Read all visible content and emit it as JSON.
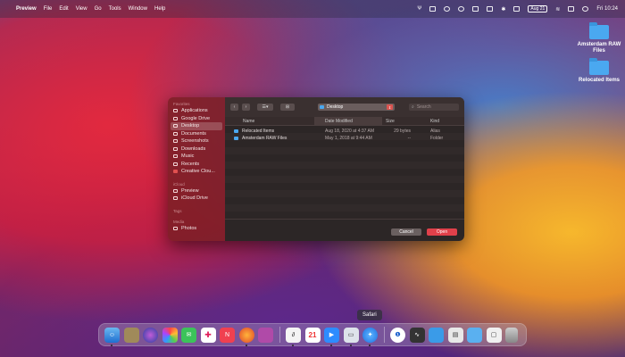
{
  "menubar": {
    "app_name": "Preview",
    "menus": [
      "File",
      "Edit",
      "View",
      "Go",
      "Tools",
      "Window",
      "Help"
    ],
    "date_chip": "Aug 21",
    "clock": "Fri 10:24"
  },
  "desktop": {
    "folders": [
      "Amsterdam RAW Files",
      "Relocated Items"
    ]
  },
  "dialog": {
    "sidebar": {
      "favorites_label": "Favorites",
      "favorites": [
        "Applications",
        "Google Drive",
        "Desktop",
        "Documents",
        "Screenshots",
        "Downloads",
        "Music",
        "Recents",
        "Creative Clou..."
      ],
      "icloud_label": "iCloud",
      "icloud": [
        "Preview",
        "iCloud Drive"
      ],
      "tags_label": "Tags",
      "media_label": "Media",
      "media": [
        "Photos"
      ]
    },
    "location": "Desktop",
    "search_placeholder": "Search",
    "columns": {
      "name": "Name",
      "date": "Date Modified",
      "size": "Size",
      "kind": "Kind"
    },
    "rows": [
      {
        "name": "Relocated Items",
        "date": "Aug 18, 2020 at 4:37 AM",
        "size": "29 bytes",
        "kind": "Alias"
      },
      {
        "name": "Amsterdam RAW Files",
        "date": "May 1, 2018 at 9:44 AM",
        "size": "--",
        "kind": "Folder"
      }
    ],
    "cancel_label": "Cancel",
    "open_label": "Open"
  },
  "tooltip": "Safari",
  "accent_color": "#e0404a"
}
